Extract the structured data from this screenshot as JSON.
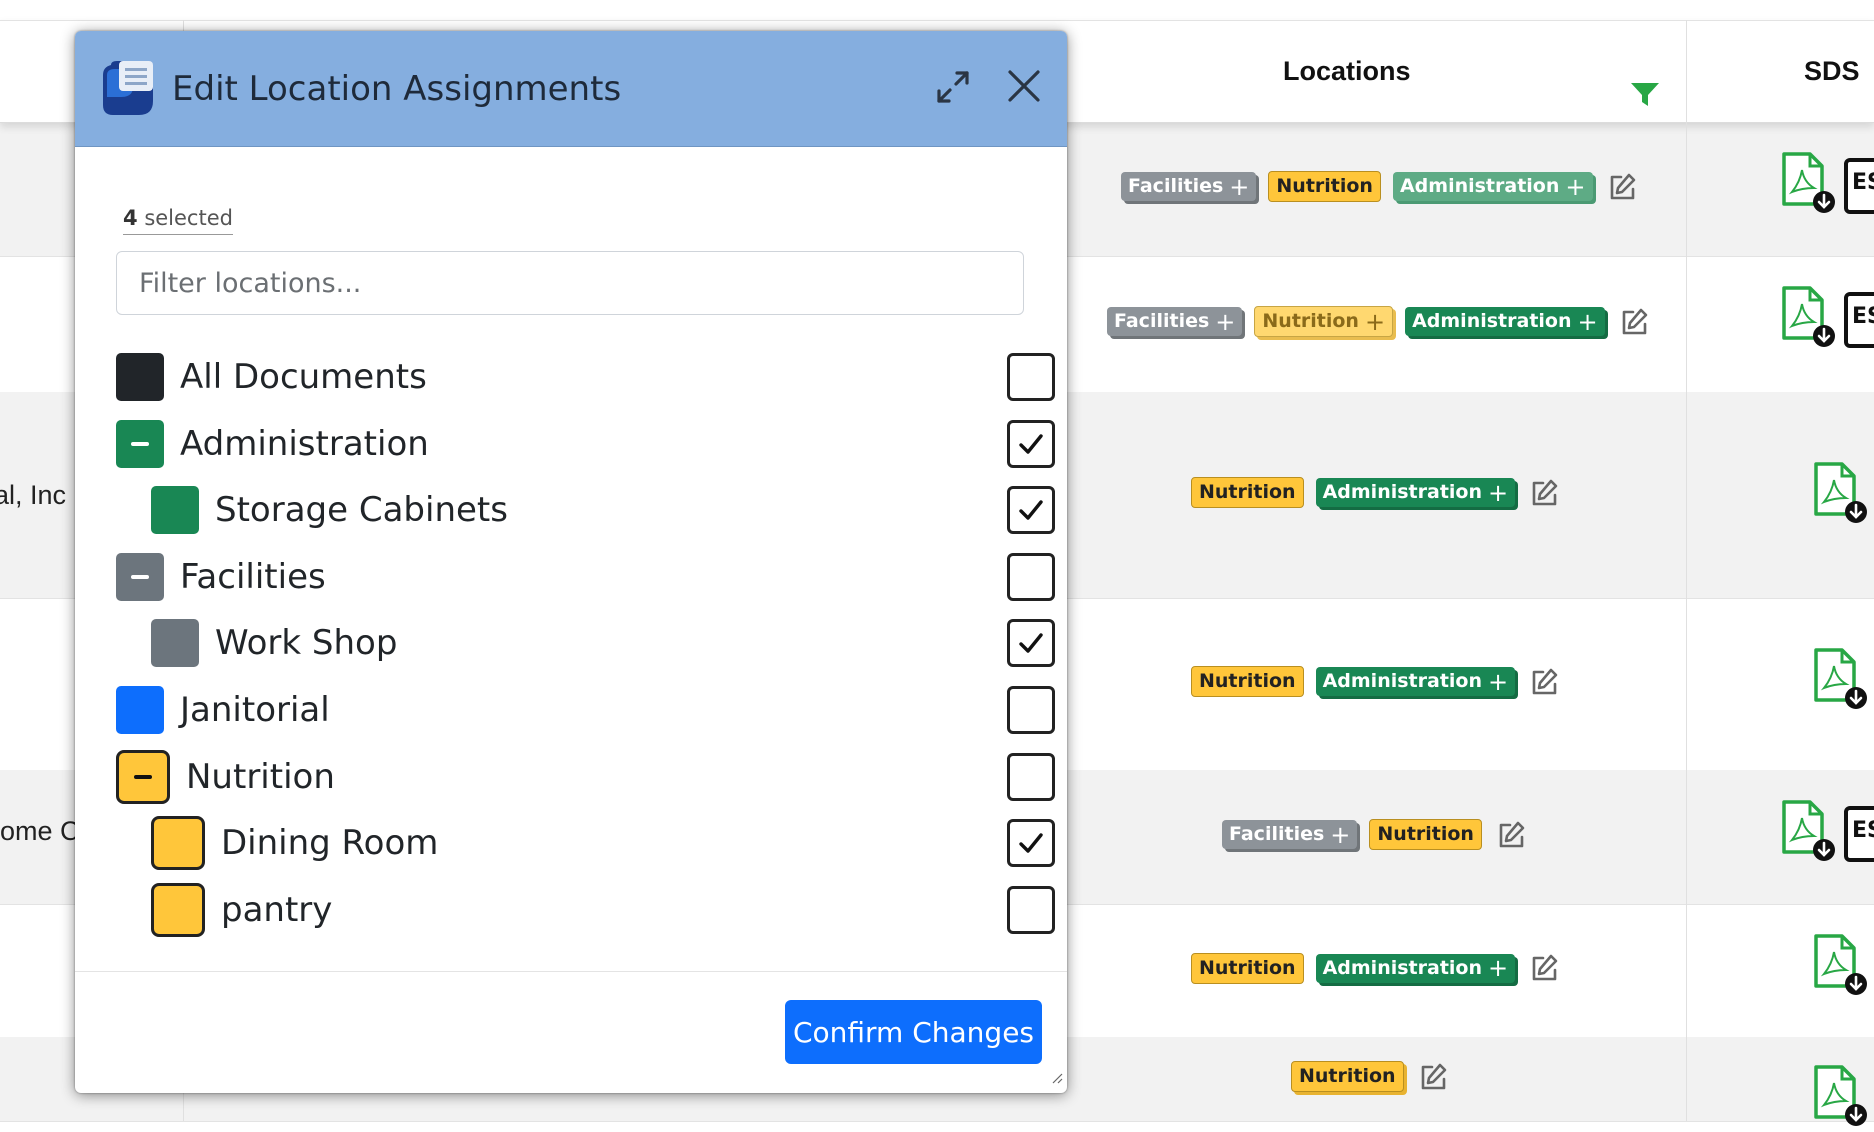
{
  "table": {
    "headers": {
      "locations": "Locations",
      "sds": "SDS"
    },
    "sds_es_label": "ES",
    "rows": [
      {
        "company": "",
        "tags": [
          {
            "label": "Facilities",
            "style": "gray",
            "plus": true
          },
          {
            "label": "Nutrition",
            "style": "yellow",
            "plus": false
          },
          {
            "label": "Administration",
            "style": "green-light",
            "plus": true
          }
        ],
        "es": true
      },
      {
        "company": "",
        "tags": [
          {
            "label": "Facilities",
            "style": "gray",
            "plus": true
          },
          {
            "label": "Nutrition",
            "style": "yellow-light",
            "plus": true
          },
          {
            "label": "Administration",
            "style": "green",
            "plus": true
          }
        ],
        "es": true
      },
      {
        "company": "al, Inc",
        "tags": [
          {
            "label": "Nutrition",
            "style": "yellow",
            "plus": false
          },
          {
            "label": "Administration",
            "style": "green",
            "plus": true
          }
        ],
        "es": false
      },
      {
        "company": "",
        "tags": [
          {
            "label": "Nutrition",
            "style": "yellow",
            "plus": false
          },
          {
            "label": "Administration",
            "style": "green",
            "plus": true
          }
        ],
        "es": false
      },
      {
        "company": "lome C",
        "tags": [
          {
            "label": "Facilities",
            "style": "gray",
            "plus": true
          },
          {
            "label": "Nutrition",
            "style": "yellow",
            "plus": false
          }
        ],
        "es": true
      },
      {
        "company": "",
        "tags": [
          {
            "label": "Nutrition",
            "style": "yellow",
            "plus": false
          },
          {
            "label": "Administration",
            "style": "green",
            "plus": true
          }
        ],
        "es": false
      },
      {
        "company": "",
        "tags": [
          {
            "label": "Nutrition",
            "style": "yellow-plain",
            "plus": false
          }
        ],
        "es": false
      }
    ]
  },
  "modal": {
    "title": "Edit Location Assignments",
    "selected_count": "4",
    "selected_suffix": "selected",
    "filter_placeholder": "Filter locations...",
    "confirm_label": "Confirm Changes",
    "locations": [
      {
        "label": "All Documents",
        "color": "#212529",
        "indent": 0,
        "group": false,
        "checked": false,
        "yellow": false
      },
      {
        "label": "Administration",
        "color": "#198754",
        "indent": 0,
        "group": true,
        "checked": true,
        "yellow": false
      },
      {
        "label": "Storage Cabinets",
        "color": "#198754",
        "indent": 1,
        "group": false,
        "checked": true,
        "yellow": false
      },
      {
        "label": "Facilities",
        "color": "#6c757d",
        "indent": 0,
        "group": true,
        "checked": false,
        "yellow": false
      },
      {
        "label": "Work Shop",
        "color": "#6c757d",
        "indent": 1,
        "group": false,
        "checked": true,
        "yellow": false
      },
      {
        "label": "Janitorial",
        "color": "#0d6efd",
        "indent": 0,
        "group": false,
        "checked": false,
        "yellow": false
      },
      {
        "label": "Nutrition",
        "color": "#ffc63a",
        "indent": 0,
        "group": true,
        "checked": false,
        "yellow": true
      },
      {
        "label": "Dining Room",
        "color": "#ffc63a",
        "indent": 1,
        "group": false,
        "checked": true,
        "yellow": true
      },
      {
        "label": "pantry",
        "color": "#ffc63a",
        "indent": 1,
        "group": false,
        "checked": false,
        "yellow": true
      }
    ]
  },
  "icons": {
    "filter": "funnel-icon",
    "edit": "pencil-square-icon",
    "pdf": "pdf-download-icon",
    "expand": "expand-icon",
    "close": "close-icon"
  },
  "colors": {
    "header_bg": "#85aedf",
    "primary": "#0d6efd",
    "green": "#198754",
    "pdf_green": "#28a745",
    "funnel_green": "#28a745"
  }
}
